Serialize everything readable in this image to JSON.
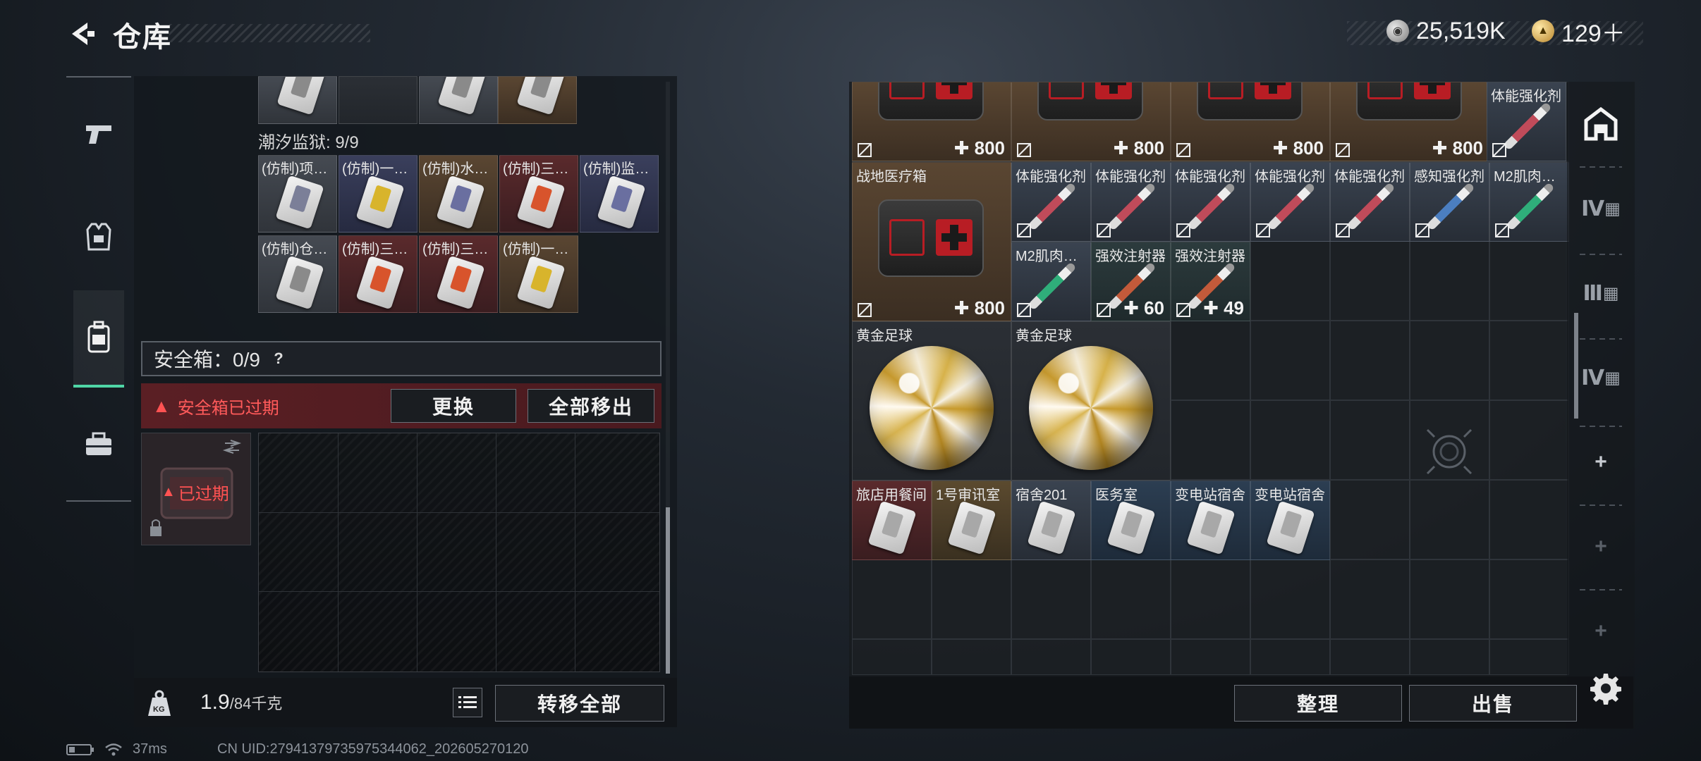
{
  "header": {
    "title": "仓库",
    "currency_silver": "25,519K",
    "currency_gold": "129＋"
  },
  "sidebar": {
    "items": [
      "weapon-tab",
      "armor-tab",
      "backpack-tab",
      "case-tab"
    ]
  },
  "left": {
    "section_label": "潮汐监狱: 9/9",
    "row1": [
      {
        "name": "(仿制)项…",
        "bg": "bg-grey",
        "stripe": "#7b7f98"
      },
      {
        "name": "(仿制)一…",
        "bg": "bg-blue",
        "stripe": "#d8b42c"
      },
      {
        "name": "(仿制)水…",
        "bg": "bg-brown",
        "stripe": "#6a6fa0"
      },
      {
        "name": "(仿制)三…",
        "bg": "bg-red",
        "stripe": "#d8542c"
      },
      {
        "name": "(仿制)监…",
        "bg": "bg-blue",
        "stripe": "#6a6fa0"
      }
    ],
    "row2": [
      {
        "name": "(仿制)仓…",
        "bg": "bg-grey",
        "stripe": "#8a8a8a"
      },
      {
        "name": "(仿制)三…",
        "bg": "bg-red",
        "stripe": "#d8542c"
      },
      {
        "name": "(仿制)三…",
        "bg": "bg-red",
        "stripe": "#d8542c"
      },
      {
        "name": "(仿制)一…",
        "bg": "bg-brown",
        "stripe": "#d8b42c"
      }
    ],
    "safe_title": "安全箱：0/9",
    "safe_help": "?",
    "safe_expired_msg": "安全箱已过期",
    "replace_btn": "更换",
    "remove_all_btn": "全部移出",
    "safe_box_status": "已过期",
    "weight_current": "1.9",
    "weight_max": "/84千克",
    "transfer_all_btn": "转移全部"
  },
  "right": {
    "top_row_counts": [
      "800",
      "800",
      "800",
      "800"
    ],
    "top_row_last_name": "体能强化剂",
    "field_kit": {
      "name": "战地医疗箱",
      "count": "800"
    },
    "row_syringes": [
      {
        "name": "体能强化剂",
        "color": "#c04b5a"
      },
      {
        "name": "体能强化剂",
        "color": "#c04b5a"
      },
      {
        "name": "体能强化剂",
        "color": "#c04b5a"
      },
      {
        "name": "体能强化剂",
        "color": "#c04b5a"
      },
      {
        "name": "体能强化剂",
        "color": "#c04b5a"
      },
      {
        "name": "感知强化剂",
        "color": "#4b7ec0"
      },
      {
        "name": "M2肌肉…",
        "color": "#2fae7a"
      }
    ],
    "row_muscle": {
      "name": "M2肌肉…",
      "color": "#2fae7a"
    },
    "row_boost1": {
      "name": "强效注射器",
      "count": "60",
      "color": "#c25a3a"
    },
    "row_boost2": {
      "name": "强效注射器",
      "count": "49",
      "color": "#c25a3a"
    },
    "balls": [
      "黄金足球",
      "黄金足球"
    ],
    "keys": [
      {
        "name": "旅店用餐间",
        "bg": "bg-red"
      },
      {
        "name": "1号审讯室",
        "bg": "bg-gold"
      },
      {
        "name": "宿舍201",
        "bg": "bg-slate"
      },
      {
        "name": "医务室",
        "bg": "bg-lblue"
      },
      {
        "name": "变电站宿舍",
        "bg": "bg-lblue"
      },
      {
        "name": "变电站宿舍",
        "bg": "bg-lblue"
      }
    ],
    "sort_btn": "整理",
    "sell_btn": "出售",
    "side_tabs": [
      "Ⅳ",
      "Ⅲ",
      "Ⅳ",
      "+",
      "+",
      "+"
    ]
  },
  "status": {
    "ping": "37ms",
    "uid": "CN UID:2794137973597534406​2_202605270120"
  }
}
